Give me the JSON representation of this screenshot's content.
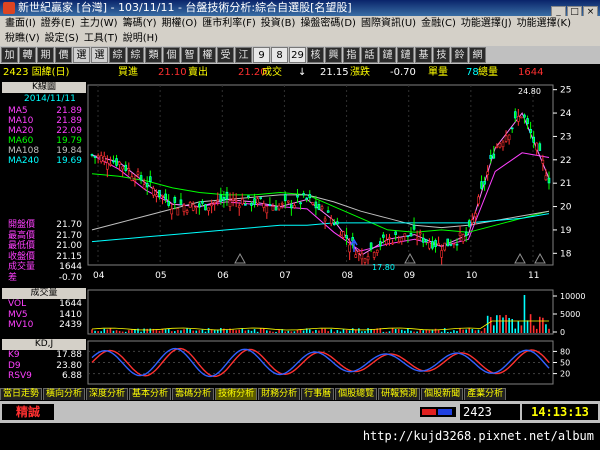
{
  "window": {
    "title": "新世紀贏家 [台灣] - 103/11/11 - 台盤技術分析:綜合自選股[名望股]"
  },
  "menus": {
    "row1": [
      "畫面(I)",
      "證券(E)",
      "主力(W)",
      "籌碼(Y)",
      "期權(O)",
      "匯市利率(F)",
      "投資(B)",
      "操盤密碼(D)",
      "國際資訊(U)",
      "金融(C)",
      "功能選擇(J)",
      "功能選擇(K)"
    ],
    "row2": [
      "稅瞧(V)",
      "設定(S)",
      "工具(T)",
      "說明(H)"
    ]
  },
  "toolbar": [
    "加",
    "轉",
    "期",
    "價",
    "選",
    "選",
    "綜",
    "綜",
    "類",
    "個",
    "智",
    "權",
    "受",
    "江",
    "9",
    "8",
    "29",
    "核",
    "興",
    "指",
    "話",
    "鏈",
    "鏈",
    "基",
    "技",
    "鈴",
    "網"
  ],
  "info": {
    "stock": "2423 固緯(日)",
    "buy_label": "買進",
    "buy": "21.10",
    "sell_label": "賣出",
    "sell": "21.20",
    "deal_label": "成交",
    "deal": "21.15",
    "change_label": "漲跌",
    "change": "-0.70",
    "amp_label": "單量",
    "amp": "78",
    "vol_label": "總量",
    "vol": "1644",
    "arrow": "↓"
  },
  "price_panel": {
    "header": "K線圖",
    "date": "2014/11/11",
    "ma": [
      {
        "label": "MA5",
        "value": "21.89",
        "color": "#ff40ff"
      },
      {
        "label": "MA10",
        "value": "21.89",
        "color": "#ff40ff"
      },
      {
        "label": "MA20",
        "value": "22.09",
        "color": "#ff40ff"
      },
      {
        "label": "MA60",
        "value": "19.79",
        "color": "#00ff00"
      },
      {
        "label": "MA108",
        "value": "19.84",
        "color": "#c0c0c0"
      },
      {
        "label": "MA240",
        "value": "19.69",
        "color": "#00ffff"
      }
    ],
    "ohlc": [
      {
        "label": "開盤價",
        "value": "21.70"
      },
      {
        "label": "最高價",
        "value": "21.70"
      },
      {
        "label": "最低價",
        "value": "21.00"
      },
      {
        "label": "收盤價",
        "value": "21.15"
      },
      {
        "label": "成交量",
        "value": "1644"
      },
      {
        "label": "差",
        "value": "-0.70"
      }
    ],
    "high_mark": "24.80",
    "low_mark": "17.80",
    "y_ticks": [
      "25",
      "24",
      "23",
      "22",
      "21",
      "20",
      "19",
      "18"
    ],
    "x_ticks": [
      "04",
      "05",
      "06",
      "07",
      "08",
      "09",
      "10",
      "11"
    ]
  },
  "volume_panel": {
    "header": "成交量",
    "items": [
      {
        "label": "VOL",
        "value": "1644",
        "color": "#ff40ff"
      },
      {
        "label": "MV5",
        "value": "1410",
        "color": "#ff40ff"
      },
      {
        "label": "MV10",
        "value": "2439",
        "color": "#ff40ff"
      }
    ],
    "y_ticks": [
      "10000",
      "5000",
      "0"
    ]
  },
  "kd_panel": {
    "header": "KD,J",
    "items": [
      {
        "label": "K9",
        "value": "17.88",
        "color": "#ff40ff"
      },
      {
        "label": "D9",
        "value": "23.80",
        "color": "#ff40ff"
      },
      {
        "label": "RSV9",
        "value": "6.88",
        "color": "#ff40ff"
      }
    ],
    "y_ticks": [
      "80",
      "50",
      "20"
    ]
  },
  "tabs": [
    "當日走勢",
    "橫向分析",
    "深度分析",
    "基本分析",
    "籌碼分析",
    "技術分析",
    "財務分析",
    "行事曆",
    "個股總覽",
    "研報預測",
    "個股新聞",
    "產業分析"
  ],
  "status": {
    "left": "精誠",
    "stock_code": "2423",
    "clock": "14:13:13"
  },
  "watermark": "http://kujd3268.pixnet.net/album",
  "chart_data": [
    {
      "type": "line",
      "series": [
        {
          "name": "MA20",
          "values": [
            22.2,
            21.6,
            20.7,
            20.1,
            20.0,
            20.2,
            20.1,
            20.0,
            19.9,
            18.9,
            18.1,
            18.4,
            18.6,
            18.3,
            18.6,
            21.5,
            22.3,
            22.1
          ]
        },
        {
          "name": "MA60",
          "values": [
            21.4,
            21.3,
            21.1,
            20.8,
            20.6,
            20.5,
            20.5,
            20.6,
            20.5,
            20.0,
            19.5,
            19.0,
            18.9,
            19.0,
            18.9,
            19.2,
            19.5,
            19.8
          ]
        },
        {
          "name": "MA108",
          "values": [
            19.0,
            19.3,
            19.6,
            19.9,
            20.2,
            20.3,
            20.4,
            20.5,
            20.5,
            20.2,
            19.8,
            19.5,
            19.2,
            19.1,
            19.2,
            19.4,
            19.6,
            19.8
          ]
        },
        {
          "name": "MA240",
          "values": [
            18.5,
            18.6,
            18.7,
            18.8,
            18.9,
            19.0,
            19.1,
            19.2,
            19.2,
            19.3,
            19.3,
            19.3,
            19.3,
            19.3,
            19.3,
            19.4,
            19.5,
            19.7
          ]
        },
        {
          "name": "Price",
          "values": [
            22.2,
            21.9,
            21.0,
            20.1,
            20.0,
            20.3,
            20.2,
            20.0,
            20.3,
            19.4,
            17.9,
            18.6,
            18.8,
            18.3,
            18.8,
            22.5,
            24.0,
            21.2
          ]
        }
      ],
      "ylim": [
        17.5,
        25.2
      ]
    }
  ]
}
